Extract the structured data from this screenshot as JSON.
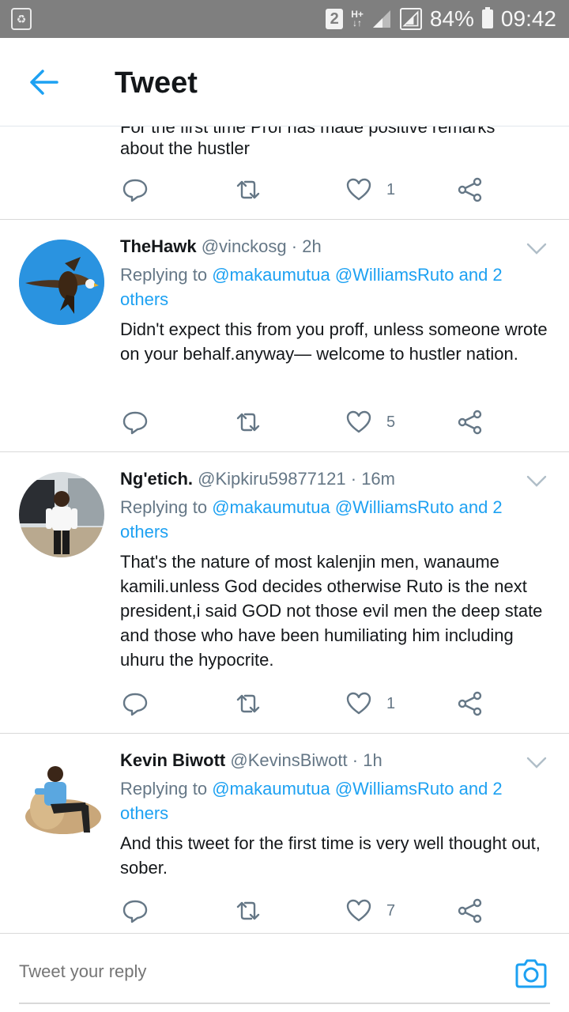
{
  "status_bar": {
    "sim": "2",
    "network": "H+",
    "battery_pct": "84%",
    "time": "09:42"
  },
  "header": {
    "title": "Tweet"
  },
  "partial_tweet": {
    "cut_text": "For the first time Prof has made positive remarks",
    "text": "about the hustler",
    "likes": "1"
  },
  "tweets": [
    {
      "name": "TheHawk",
      "handle": "@vinckosg",
      "time": "· 2h",
      "replying_prefix": "Replying to",
      "replying_links": "@makaumutua @WilliamsRuto and 2 others",
      "body": "Didn't expect this from you proff, unless someone wrote on your behalf.anyway— welcome to hustler nation.",
      "likes": "5"
    },
    {
      "name": "Ng'etich.",
      "handle": "@Kipkiru59877121",
      "time": "· 16m",
      "replying_prefix": "Replying to",
      "replying_links": "@makaumutua @WilliamsRuto and 2 others",
      "body": "That's the nature of most kalenjin men, wanaume kamili.unless God decides otherwise Ruto is the next president,i said GOD not those evil men the deep state and those who have been humiliating him including uhuru the hypocrite.",
      "likes": "1"
    },
    {
      "name": "Kevin Biwott",
      "handle": "@KevinsBiwott",
      "time": "· 1h",
      "replying_prefix": "Replying to",
      "replying_links": "@makaumutua @WilliamsRuto and 2 others",
      "body": "And this tweet for the first time is very well thought out, sober.",
      "likes": "7"
    }
  ],
  "reply_bar": {
    "placeholder": "Tweet your reply"
  },
  "colors": {
    "accent": "#1da1f2",
    "secondary_text": "#657786",
    "primary_text": "#14171a",
    "status_bar": "#7f7f7f"
  }
}
